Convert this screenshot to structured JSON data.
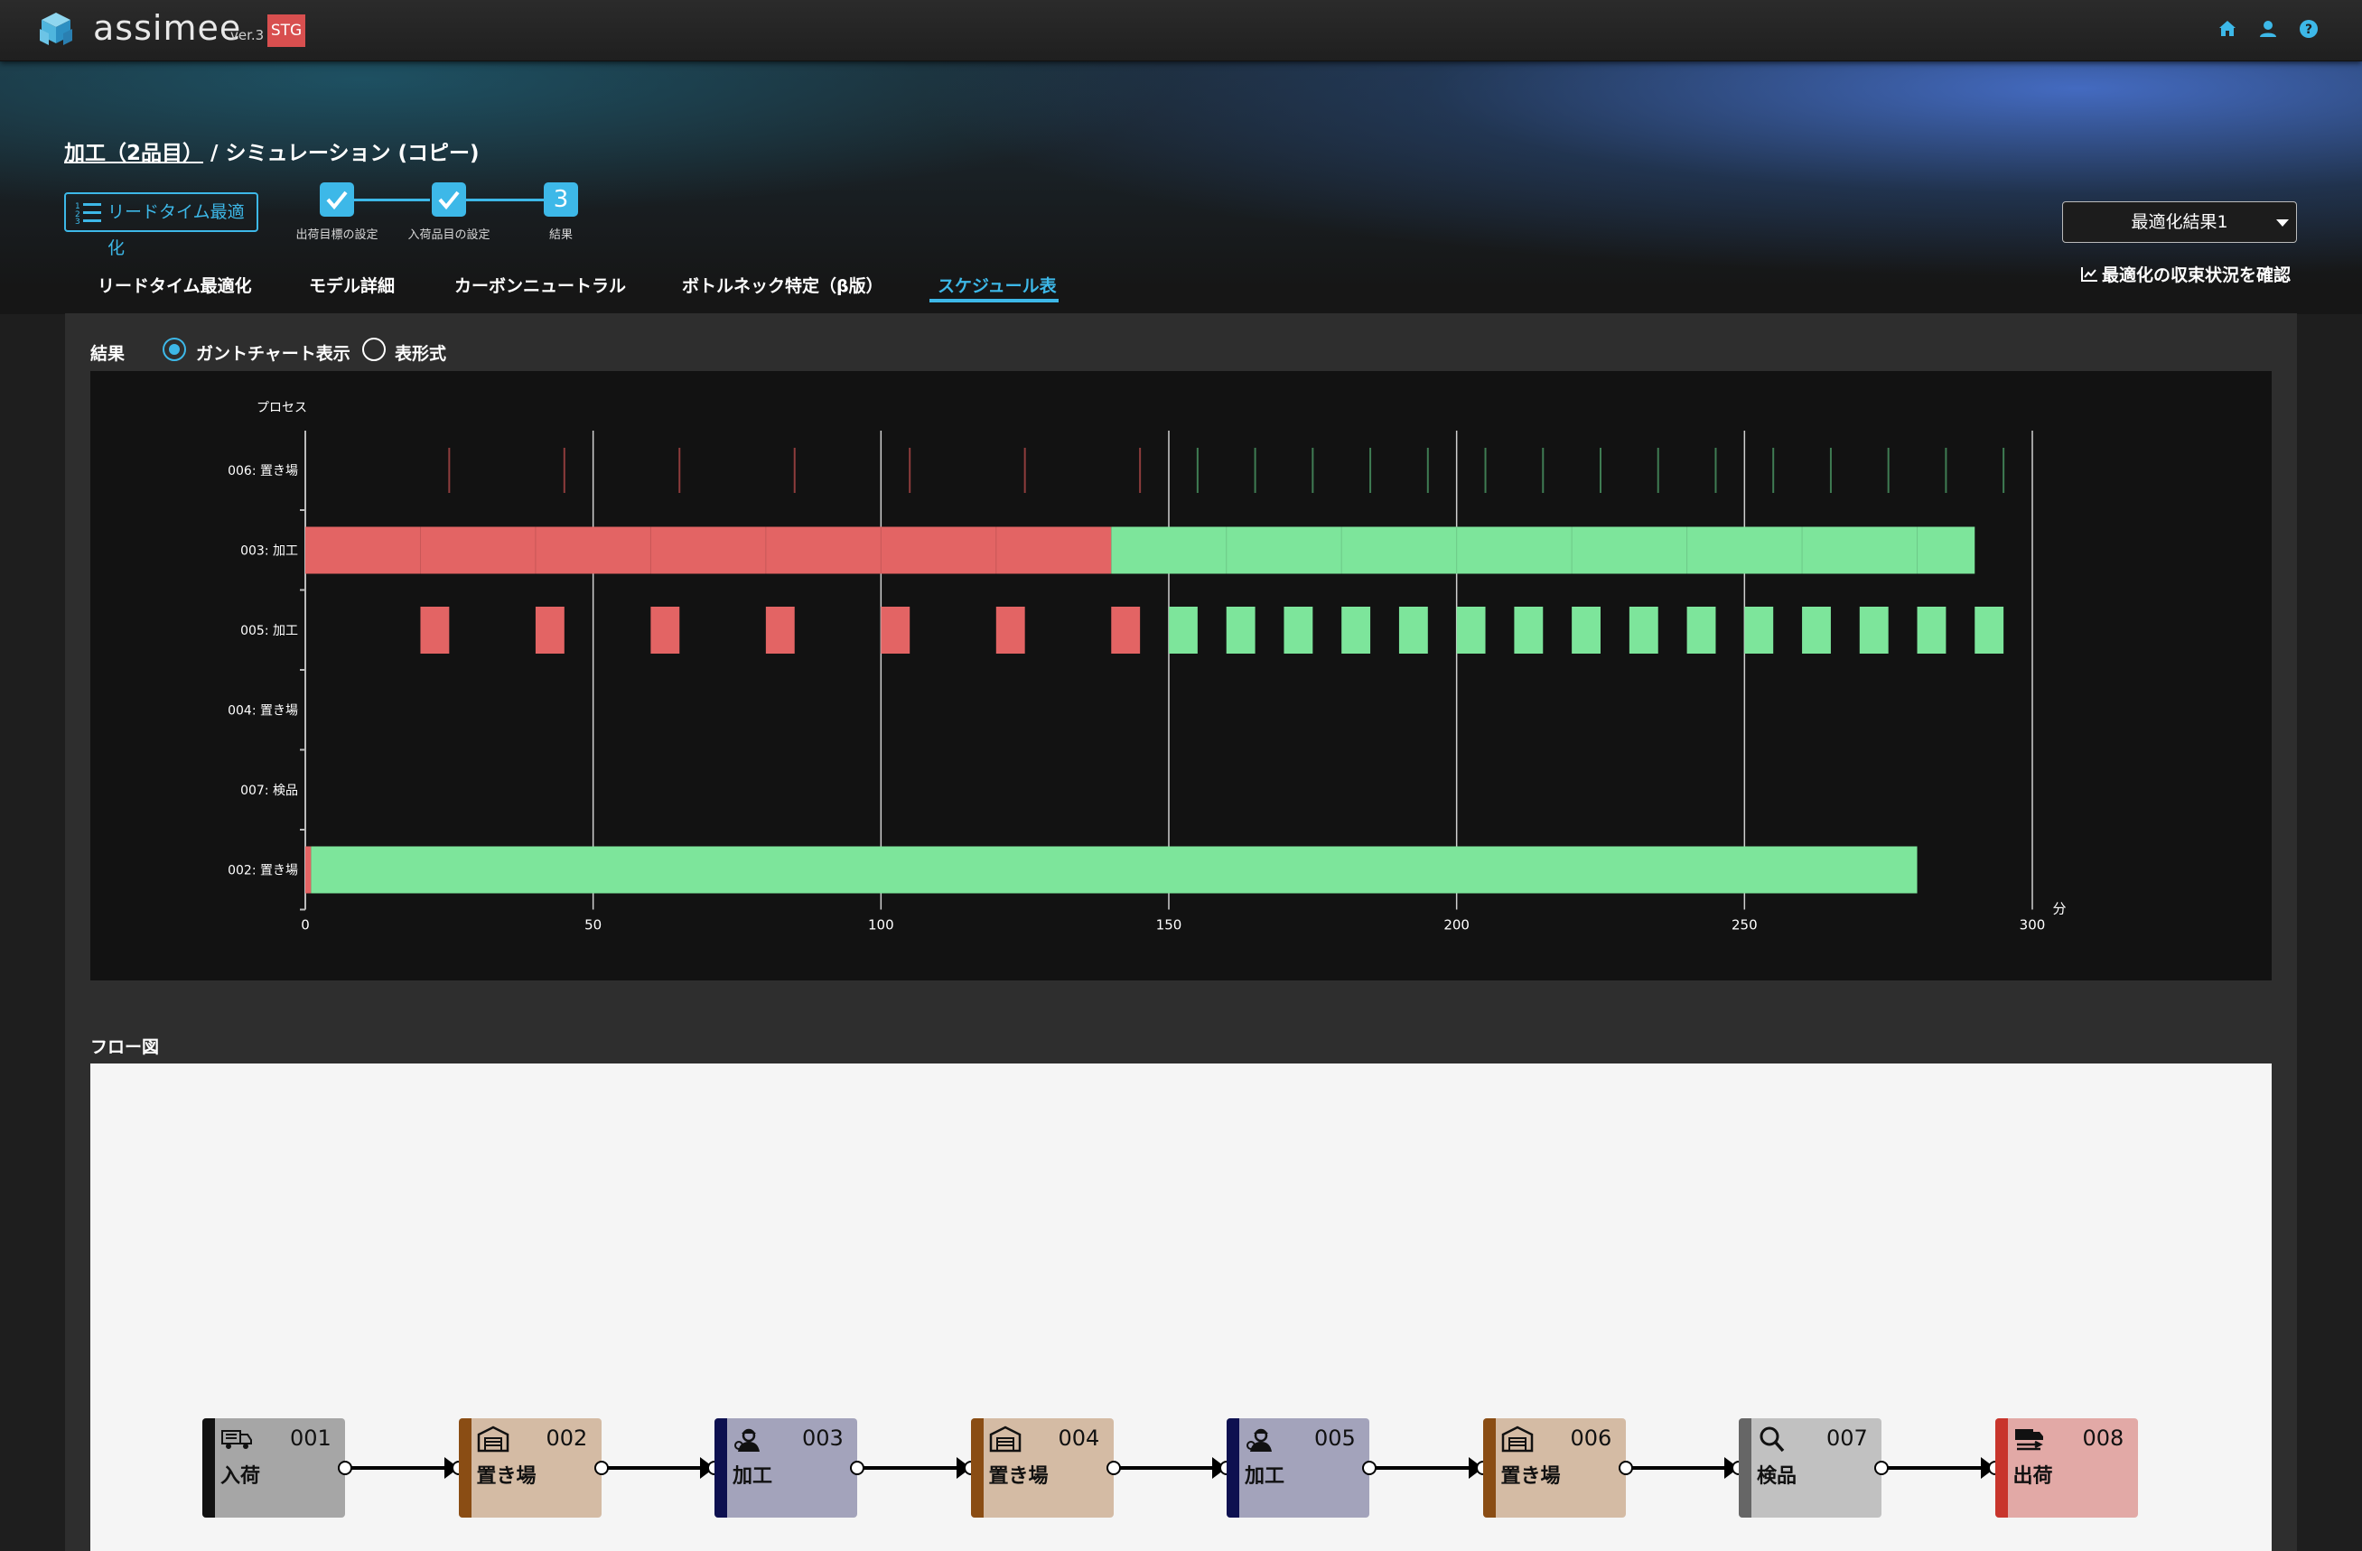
{
  "app": {
    "name": "assimee",
    "version": "ver.3",
    "env": "STG"
  },
  "header_icons": [
    "home-icon",
    "user-icon",
    "help-icon"
  ],
  "breadcrumb": {
    "project": "加工（2品目）",
    "separator": " / ",
    "page": "シミュレーション (コピー)"
  },
  "mode_button": "リードタイム最適化",
  "stepper": {
    "steps": [
      {
        "label": "出荷目標の設定",
        "state": "done"
      },
      {
        "label": "入荷品目の設定",
        "state": "done"
      },
      {
        "label": "結果",
        "state": "current",
        "number": "3"
      }
    ]
  },
  "tabs": [
    {
      "label": "リードタイム最適化",
      "active": false
    },
    {
      "label": "モデル詳細",
      "active": false
    },
    {
      "label": "カーボンニュートラル",
      "active": false
    },
    {
      "label": "ボトルネック特定（β版）",
      "active": false
    },
    {
      "label": "スケジュール表",
      "active": true
    }
  ],
  "result_select": {
    "value": "最適化結果1"
  },
  "convergence_link": "最適化の収束状況を確認",
  "results": {
    "label": "結果",
    "views": [
      {
        "label": "ガントチャート表示",
        "selected": true
      },
      {
        "label": "表形式",
        "selected": false
      }
    ]
  },
  "colors": {
    "accent": "#3db8e8",
    "red_item": "#e36464",
    "green_item": "#7de59b"
  },
  "chart_data": {
    "type": "gantt",
    "ylabel": "プロセス",
    "xlabel": "分",
    "xlim": [
      0,
      300
    ],
    "xticks": [
      0,
      50,
      100,
      150,
      200,
      250,
      300
    ],
    "rows": [
      "006: 置き場",
      "003: 加工",
      "005: 加工",
      "004: 置き場",
      "007: 検品",
      "002: 置き場"
    ],
    "series": [
      {
        "name": "red",
        "color": "#e36464"
      },
      {
        "name": "green",
        "color": "#7de59b"
      }
    ],
    "tasks": [
      {
        "row": "003: 加工",
        "item": "red",
        "start": 0,
        "end": 140
      },
      {
        "row": "003: 加工",
        "item": "green",
        "start": 140,
        "end": 290
      },
      {
        "row": "002: 置き場",
        "item": "red",
        "start": 0,
        "end": 1
      },
      {
        "row": "002: 置き場",
        "item": "green",
        "start": 1,
        "end": 280
      },
      {
        "row": "005: 加工",
        "item": "red",
        "start": 20,
        "end": 25
      },
      {
        "row": "005: 加工",
        "item": "red",
        "start": 40,
        "end": 45
      },
      {
        "row": "005: 加工",
        "item": "red",
        "start": 60,
        "end": 65
      },
      {
        "row": "005: 加工",
        "item": "red",
        "start": 80,
        "end": 85
      },
      {
        "row": "005: 加工",
        "item": "red",
        "start": 100,
        "end": 105
      },
      {
        "row": "005: 加工",
        "item": "red",
        "start": 120,
        "end": 125
      },
      {
        "row": "005: 加工",
        "item": "red",
        "start": 140,
        "end": 145
      },
      {
        "row": "005: 加工",
        "item": "green",
        "start": 150,
        "end": 155
      },
      {
        "row": "005: 加工",
        "item": "green",
        "start": 160,
        "end": 165
      },
      {
        "row": "005: 加工",
        "item": "green",
        "start": 170,
        "end": 175
      },
      {
        "row": "005: 加工",
        "item": "green",
        "start": 180,
        "end": 185
      },
      {
        "row": "005: 加工",
        "item": "green",
        "start": 190,
        "end": 195
      },
      {
        "row": "005: 加工",
        "item": "green",
        "start": 200,
        "end": 205
      },
      {
        "row": "005: 加工",
        "item": "green",
        "start": 210,
        "end": 215
      },
      {
        "row": "005: 加工",
        "item": "green",
        "start": 220,
        "end": 225
      },
      {
        "row": "005: 加工",
        "item": "green",
        "start": 230,
        "end": 235
      },
      {
        "row": "005: 加工",
        "item": "green",
        "start": 240,
        "end": 245
      },
      {
        "row": "005: 加工",
        "item": "green",
        "start": 250,
        "end": 255
      },
      {
        "row": "005: 加工",
        "item": "green",
        "start": 260,
        "end": 265
      },
      {
        "row": "005: 加工",
        "item": "green",
        "start": 270,
        "end": 275
      },
      {
        "row": "005: 加工",
        "item": "green",
        "start": 280,
        "end": 285
      },
      {
        "row": "005: 加工",
        "item": "green",
        "start": 290,
        "end": 295
      }
    ],
    "events": [
      {
        "row": "006: 置き場",
        "item": "red",
        "times": [
          25,
          45,
          65,
          85,
          105,
          125,
          145
        ]
      },
      {
        "row": "006: 置き場",
        "item": "green",
        "times": [
          155,
          165,
          175,
          185,
          195,
          205,
          215,
          225,
          235,
          245,
          255,
          265,
          275,
          285,
          295
        ]
      }
    ],
    "grid": true
  },
  "flow": {
    "label": "フロー図",
    "nodes": [
      {
        "id": "001",
        "name": "入荷",
        "icon": "truck-icon",
        "color": "#a6a6a6",
        "bar": "#111111"
      },
      {
        "id": "002",
        "name": "置き場",
        "icon": "warehouse-icon",
        "color": "#d4bba4",
        "bar": "#8a4d14"
      },
      {
        "id": "003",
        "name": "加工",
        "icon": "worker-icon",
        "color": "#a3a3bb",
        "bar": "#0d1050"
      },
      {
        "id": "004",
        "name": "置き場",
        "icon": "warehouse-icon",
        "color": "#d4bba4",
        "bar": "#8a4d14"
      },
      {
        "id": "005",
        "name": "加工",
        "icon": "worker-icon",
        "color": "#a3a3bb",
        "bar": "#0d1050"
      },
      {
        "id": "006",
        "name": "置き場",
        "icon": "warehouse-icon",
        "color": "#d4bba4",
        "bar": "#8a4d14"
      },
      {
        "id": "007",
        "name": "検品",
        "icon": "magnifier-icon",
        "color": "#c1c1c1",
        "bar": "#666666"
      },
      {
        "id": "008",
        "name": "出荷",
        "icon": "shipping-truck-icon",
        "color": "#e2a9a6",
        "bar": "#c8352c"
      }
    ]
  }
}
